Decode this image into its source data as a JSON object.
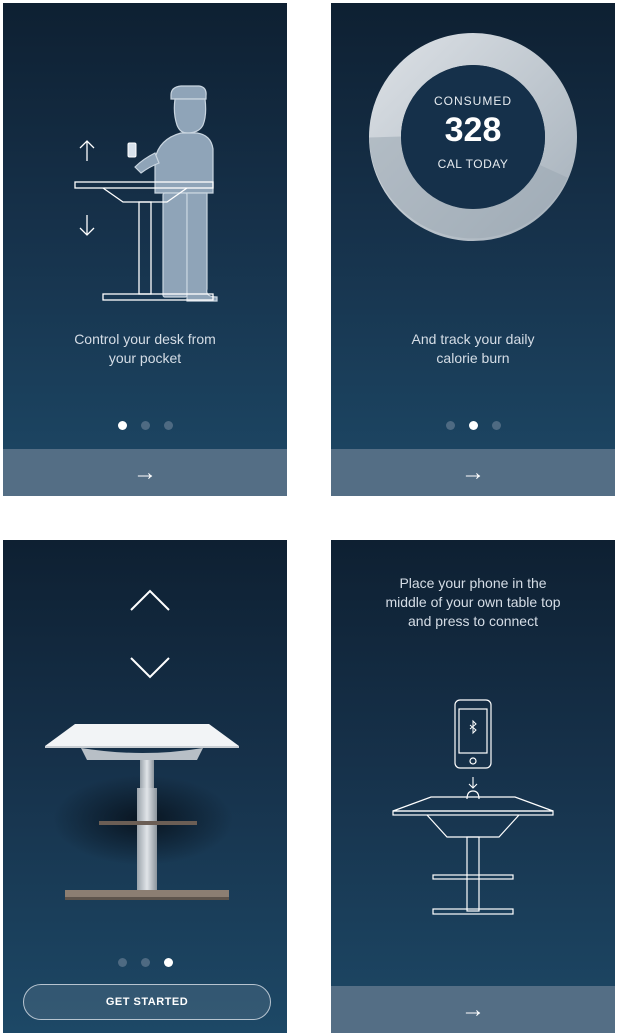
{
  "screens": [
    {
      "caption_line1": "Control your desk from",
      "caption_line2": "your pocket",
      "arrow": "→"
    },
    {
      "ring_label_top": "CONSUMED",
      "ring_value": "328",
      "ring_label_bottom": "CAL TODAY",
      "caption_line1": "And track your daily",
      "caption_line2": "calorie burn",
      "arrow": "→"
    },
    {
      "button_label": "GET STARTED",
      "up_icon": "chevron-up-icon",
      "down_icon": "chevron-down-icon"
    },
    {
      "caption_line1": "Place your phone in the",
      "caption_line2": "middle of your own table top",
      "caption_line3": "and press to connect",
      "arrow": "→"
    }
  ],
  "pagination": {
    "count": 3,
    "active": [
      1,
      2,
      3
    ]
  },
  "colors": {
    "background_top": "#0e2032",
    "background_bottom": "#1d4866",
    "bar": "#546e85",
    "dot_inactive": "#4e6a82",
    "dot_active": "#ffffff"
  }
}
